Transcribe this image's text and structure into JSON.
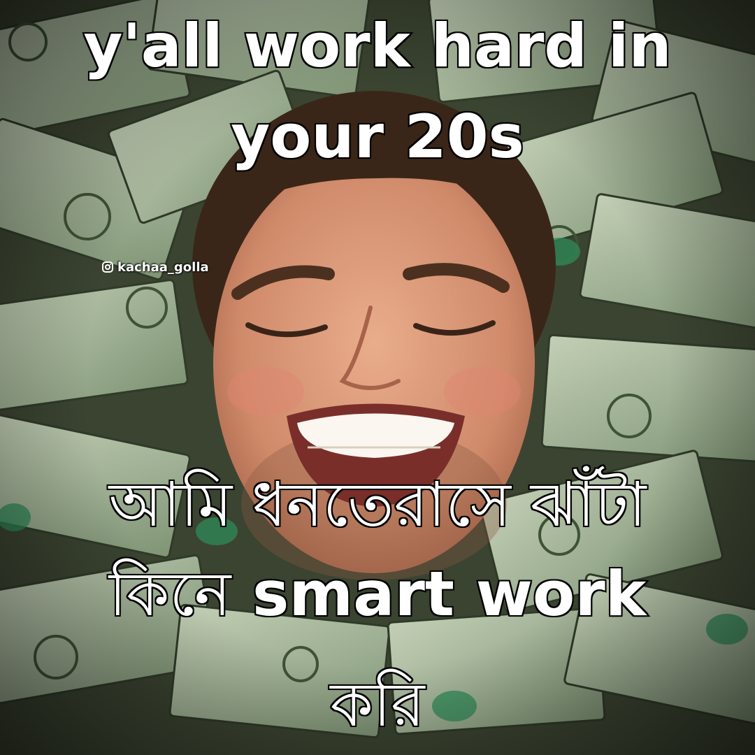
{
  "caption": {
    "top_line_1": "y'all work hard in",
    "top_line_2": "your 20s",
    "bottom_line_1": "আমি ধনতেরাসে ঝাঁটা",
    "bottom_line_2_bengali": "কিনে",
    "bottom_line_2_english": "smart work",
    "bottom_line_3": "করি"
  },
  "watermark": {
    "handle": "kachaa_golla",
    "icon": "instagram-icon"
  },
  "colors": {
    "caption_fill": "#ffffff",
    "caption_stroke": "#000000",
    "banknote_green": "#8fa58a",
    "skin": "#d9967a"
  }
}
